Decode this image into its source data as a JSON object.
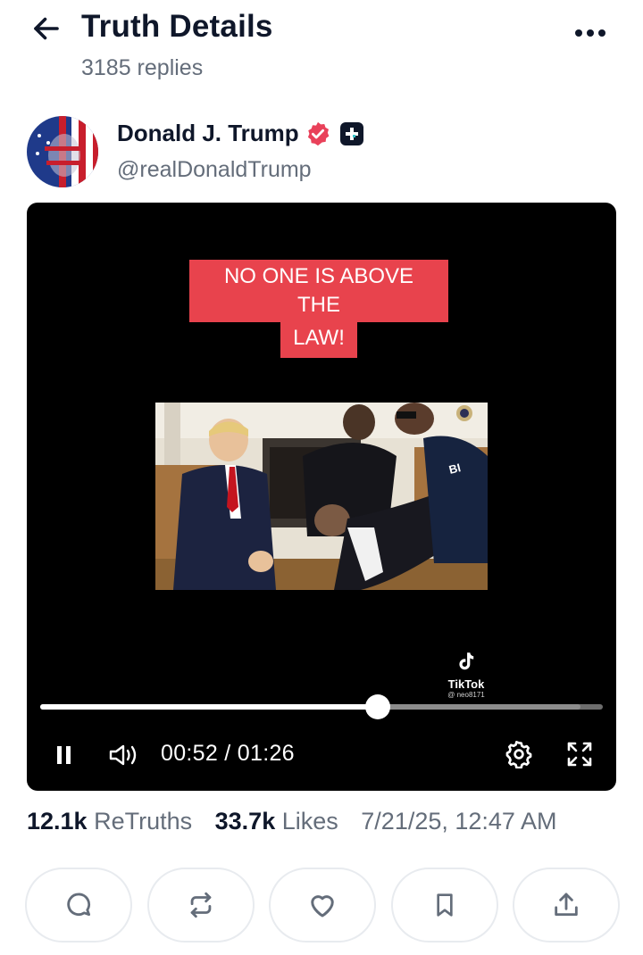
{
  "header": {
    "title": "Truth Details",
    "reply_count": "3185 replies"
  },
  "author": {
    "name": "Donald J. Trump",
    "handle": "@realDonaldTrump"
  },
  "video": {
    "overlay_line1": "NO ONE IS ABOVE THE",
    "overlay_line2": "LAW!",
    "watermark_name": "TikTok",
    "watermark_user": "@ neo8171",
    "current_time": "00:52",
    "duration": "01:26",
    "time_display": "00:52 / 01:26",
    "progress_fraction": 0.6,
    "buffered_fraction": 0.96
  },
  "stats": {
    "retruths_count": "12.1k",
    "retruths_label": "ReTruths",
    "likes_count": "33.7k",
    "likes_label": "Likes",
    "timestamp": "7/21/25, 12:47 AM"
  },
  "colors": {
    "overlay_red": "#e8434d",
    "verified_pink": "#e9415a",
    "text_primary": "#0f172a",
    "text_muted": "#646d7a"
  },
  "icons": {
    "back": "arrow-left-icon",
    "more": "more-horizontal-icon",
    "verified": "verified-badge-icon",
    "plus": "truth-plus-icon",
    "pause": "pause-icon",
    "volume": "volume-icon",
    "settings": "gear-icon",
    "fullscreen": "fullscreen-icon",
    "reply": "comment-icon",
    "retruth": "repost-icon",
    "like": "heart-icon",
    "bookmark": "bookmark-icon",
    "share": "share-icon"
  }
}
